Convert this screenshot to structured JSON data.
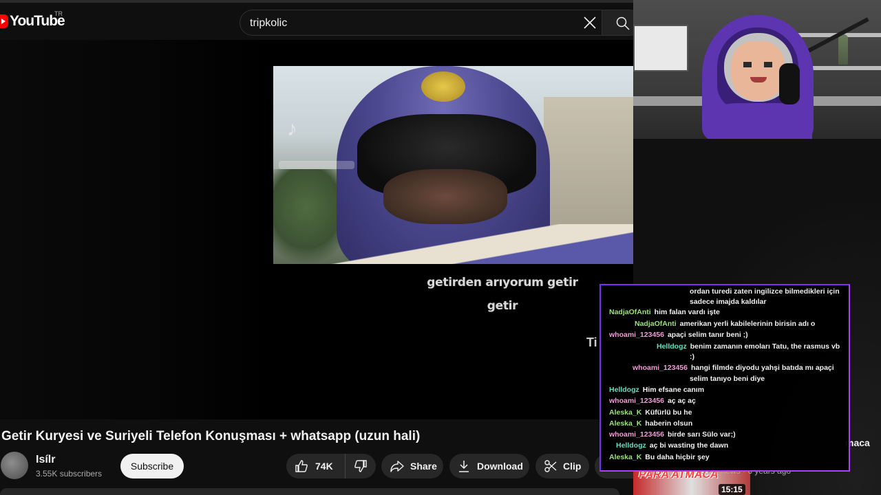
{
  "header": {
    "logo_text": "YouTube",
    "country_code": "TR",
    "search_value": "tripkolic"
  },
  "video": {
    "subtitle_line1": "getirden arıyorum getir",
    "subtitle_line2": "getir",
    "tiktok_fragment": "Ti",
    "title": "Getir Kuryesi ve Suriyeli Telefon Konuşması + whatsapp (uzun hali)"
  },
  "channel": {
    "name": "Isílr",
    "subscribers": "3.55K subscribers",
    "subscribe_label": "Subscribe"
  },
  "actions": {
    "like_count": "74K",
    "share_label": "Share",
    "download_label": "Download",
    "clip_label": "Clip"
  },
  "recommendation": {
    "title_fragment": "maca",
    "meta": "orum news · 6 years ago",
    "thumb_text": "PARA ATMACA",
    "duration": "15:15"
  },
  "chat": {
    "colors": {
      "green": "#9be37a",
      "pink": "#ef9fd6",
      "teal": "#5fe0c0",
      "border": "#7b2cff"
    },
    "messages": [
      {
        "user": "",
        "text": "ordan turedi zaten ingilizce bilmedikleri için",
        "color": "green"
      },
      {
        "user": "",
        "text": "sadece imajda kaldılar",
        "color": "green"
      },
      {
        "user": "NadjaOfAnti",
        "text": "him falan vardı işte",
        "color": "green"
      },
      {
        "user": "NadjaOfAnti",
        "text": "amerikan yerli kabilelerinin birisin adı o",
        "color": "green"
      },
      {
        "user": "whoami_123456",
        "text": "apaçi selim tanır beni ;)",
        "color": "pink"
      },
      {
        "user": "Helldogz",
        "text": "benim zamanın emoları Tatu, the rasmus vb",
        "color": "teal"
      },
      {
        "user": "",
        "text": ":)",
        "color": "teal"
      },
      {
        "user": "whoami_123456",
        "text": "hangi filmde diyodu yahşi batıda mı apaçi",
        "color": "pink"
      },
      {
        "user": "",
        "text": "selim tanıyo beni diye",
        "color": "pink"
      },
      {
        "user": "Helldogz",
        "text": "Him efsane canım",
        "color": "teal"
      },
      {
        "user": "whoami_123456",
        "text": "aç aç aç",
        "color": "pink"
      },
      {
        "user": "Aleska_K",
        "text": "Küfürlü bu he",
        "color": "green"
      },
      {
        "user": "Aleska_K",
        "text": "haberin olsun",
        "color": "green"
      },
      {
        "user": "whoami_123456",
        "text": "birde sarı Sülo var;)",
        "color": "pink"
      },
      {
        "user": "Helldogz",
        "text": "aç bi wasting the dawn",
        "color": "teal"
      },
      {
        "user": "Aleska_K",
        "text": "Bu daha hiçbir şey",
        "color": "green"
      }
    ]
  }
}
